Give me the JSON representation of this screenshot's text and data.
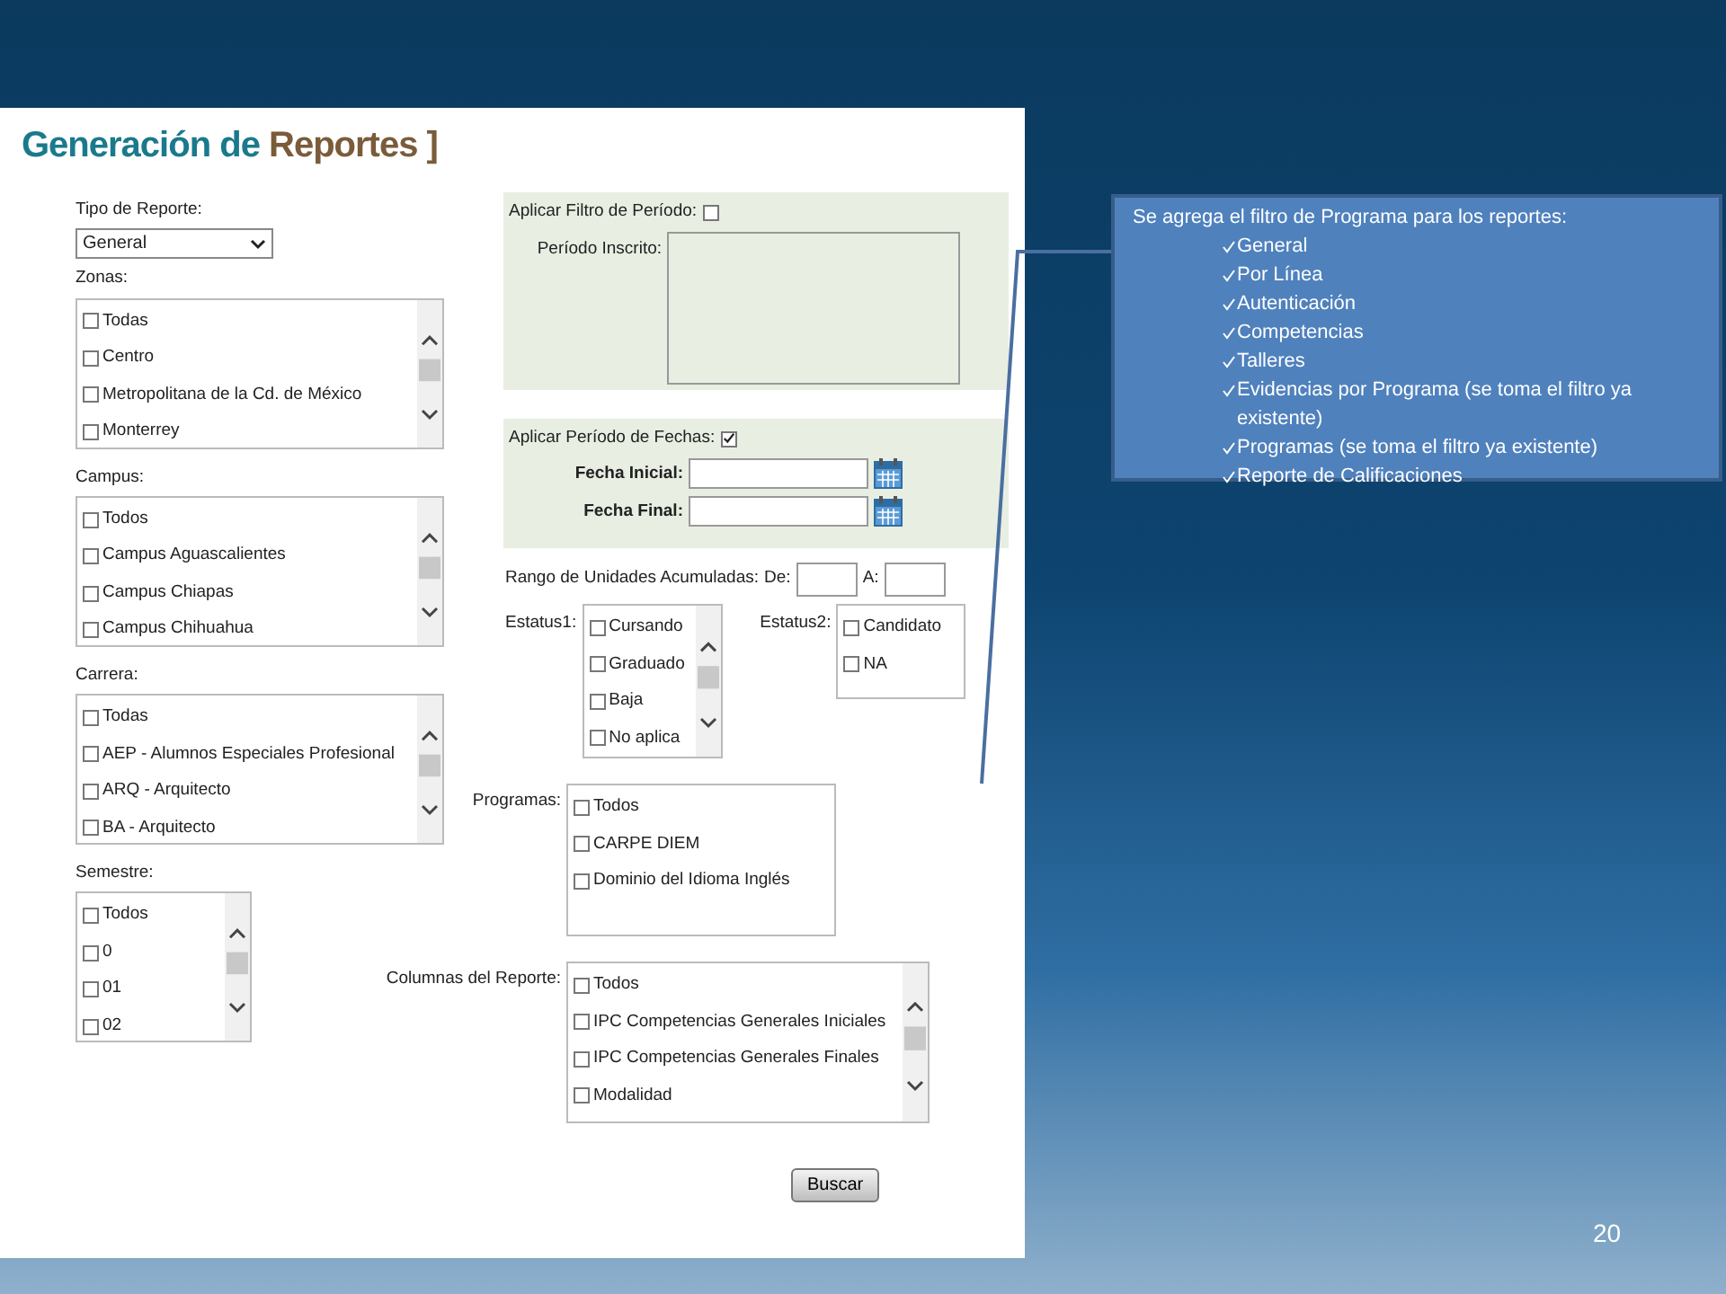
{
  "screenshot": {
    "title": "Generación de",
    "title_accent": "Reportes",
    "title_bracket": "]",
    "left": {
      "report_type": {
        "label": "Tipo de Reporte:",
        "value": "General"
      },
      "lists": [
        {
          "label": "Zonas:",
          "scroll": true,
          "items": [
            {
              "label": "Todas",
              "checked": false
            },
            {
              "label": "Centro",
              "checked": false
            },
            {
              "label": "Metropolitana de la Cd. de México",
              "checked": false
            },
            {
              "label": "Monterrey",
              "checked": false
            }
          ]
        },
        {
          "label": "Campus:",
          "scroll": true,
          "items": [
            {
              "label": "Todos",
              "checked": false
            },
            {
              "label": "Campus Aguascalientes",
              "checked": false
            },
            {
              "label": "Campus Chiapas",
              "checked": false
            },
            {
              "label": "Campus Chihuahua",
              "checked": false
            }
          ]
        },
        {
          "label": "Carrera:",
          "scroll": true,
          "items": [
            {
              "label": "Todas",
              "checked": false
            },
            {
              "label": "AEP - Alumnos Especiales Profesional",
              "checked": false
            },
            {
              "label": "ARQ - Arquitecto",
              "checked": false
            },
            {
              "label": "BA - Arquitecto",
              "checked": false
            }
          ]
        },
        {
          "label": "Semestre:",
          "scroll": true,
          "items": [
            {
              "label": "Todos",
              "checked": false
            },
            {
              "label": "0",
              "checked": false
            },
            {
              "label": "01",
              "checked": false
            },
            {
              "label": "02",
              "checked": false
            }
          ]
        }
      ]
    },
    "period_filter": {
      "label": "Aplicar Filtro de Período:",
      "checked": false,
      "enrolled_label": "Período Inscrito:"
    },
    "date_filter": {
      "label": "Aplicar Período de Fechas:",
      "checked": true,
      "start_label": "Fecha Inicial:",
      "end_label": "Fecha Final:"
    },
    "units_range": {
      "label": "Rango de Unidades Acumuladas:",
      "from_label": "De:",
      "to_label": "A:"
    },
    "status1": {
      "label": "Estatus1:",
      "scroll": true,
      "items": [
        {
          "label": "Cursando",
          "checked": false
        },
        {
          "label": "Graduado",
          "checked": false
        },
        {
          "label": "Baja",
          "checked": false
        },
        {
          "label": "No aplica",
          "checked": false
        }
      ]
    },
    "status2": {
      "label": "Estatus2:",
      "scroll": false,
      "items": [
        {
          "label": "Candidato",
          "checked": false
        },
        {
          "label": "NA",
          "checked": false
        }
      ]
    },
    "programs": {
      "label": "Programas:",
      "scroll": false,
      "items": [
        {
          "label": "Todos",
          "checked": false
        },
        {
          "label": "CARPE DIEM",
          "checked": false
        },
        {
          "label": "Dominio del Idioma Inglés",
          "checked": false
        }
      ]
    },
    "columns": {
      "label": "Columnas del Reporte:",
      "scroll": true,
      "items": [
        {
          "label": "Todos",
          "checked": false
        },
        {
          "label": "IPC Competencias Generales Iniciales",
          "checked": false
        },
        {
          "label": "IPC Competencias Generales Finales",
          "checked": false
        },
        {
          "label": "Modalidad",
          "checked": false
        }
      ]
    },
    "search_button": "Buscar"
  },
  "callout": {
    "intro": "Se agrega el filtro de Programa para los reportes:",
    "items": [
      "General",
      "Por Línea",
      "Autenticación",
      "Competencias",
      "Talleres",
      "Evidencias por Programa (se toma el filtro ya existente)",
      "Programas (se toma el filtro ya existente)",
      "Reporte de Calificaciones"
    ]
  },
  "page_number": "20"
}
